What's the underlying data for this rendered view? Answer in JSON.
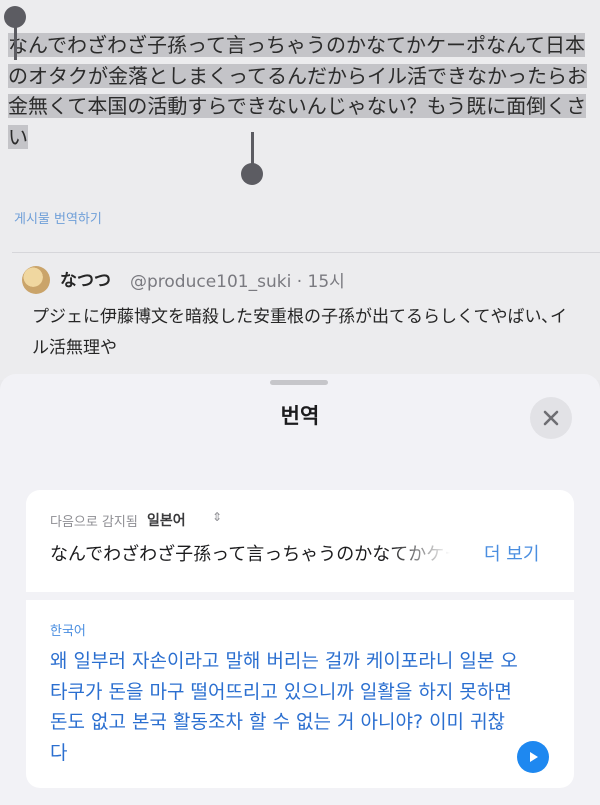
{
  "tweet": {
    "text": "なんでわざわざ子孫って言っちゃうのかなてかケーポなんて日本のオタクが金落としまくってるんだからイル活できなかったらお金無くて本国の活動すらできないんじゃない？もう既に面倒くさい",
    "translate_link": "게시물 번역하기"
  },
  "quote": {
    "name": "なつつ",
    "handle_time": "@produce101_suki · 15시",
    "text": "プジェに伊藤博文を暗殺した安重根の子孫が出てるらしくてやばい､イル活無理や"
  },
  "sheet": {
    "title": "번역",
    "detected_label": "다음으로 감지됨",
    "detected_language": "일본어",
    "source_text": "なんでわざわざ子孫って言っちゃうのかなてかケーポなんて",
    "more_label": "더 보기",
    "target_language": "한국어",
    "translation": "왜 일부러 자손이라고 말해 버리는 걸까 케이포라니 일본 오타쿠가 돈을 마구 떨어뜨리고 있으니까 일활을 하지 못하면 돈도 없고 본국 활동조차 할 수 없는 거 아니야? 이미 귀찮다"
  },
  "icons": {
    "close": "close-icon",
    "play": "play-icon",
    "chevron": "chevron-up-down-icon"
  },
  "colors": {
    "accent": "#1e88f0",
    "translation_text": "#2b6fd0",
    "selection": "#c4c4c8"
  }
}
